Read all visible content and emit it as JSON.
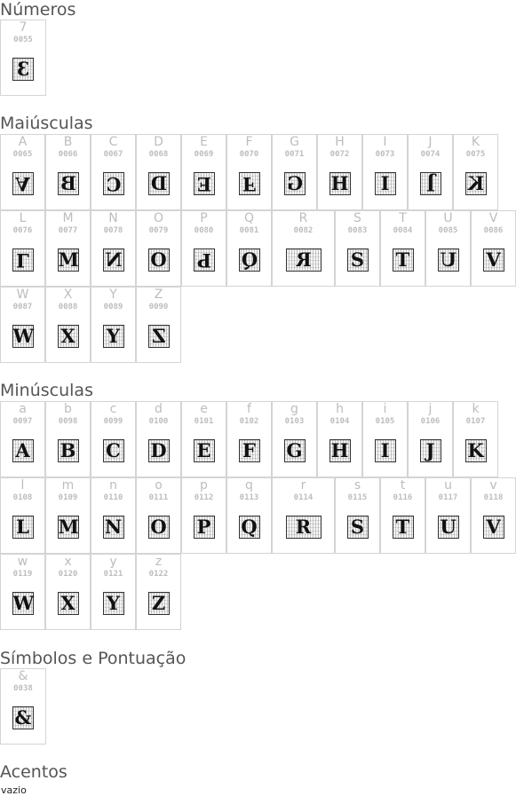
{
  "sections": {
    "numeros": {
      "title": "Números",
      "cells": [
        {
          "char": "7",
          "code": "0055",
          "glyph": "3",
          "transform": "mirror"
        }
      ]
    },
    "maiusculas": {
      "title": "Maiúsculas",
      "cells": [
        {
          "char": "A",
          "code": "0065",
          "glyph": "A",
          "transform": "flip"
        },
        {
          "char": "B",
          "code": "0066",
          "glyph": "B",
          "transform": "mirror"
        },
        {
          "char": "C",
          "code": "0067",
          "glyph": "C",
          "transform": "rot"
        },
        {
          "char": "D",
          "code": "0068",
          "glyph": "D",
          "transform": "mirror"
        },
        {
          "char": "E",
          "code": "0069",
          "glyph": "E",
          "transform": "rot"
        },
        {
          "char": "F",
          "code": "0070",
          "glyph": "F",
          "transform": "flip"
        },
        {
          "char": "G",
          "code": "0071",
          "glyph": "G",
          "transform": "mirror"
        },
        {
          "char": "H",
          "code": "0072",
          "glyph": "H",
          "transform": "none"
        },
        {
          "char": "I",
          "code": "0073",
          "glyph": "I",
          "transform": "none"
        },
        {
          "char": "J",
          "code": "0074",
          "glyph": "J",
          "transform": "rot"
        },
        {
          "char": "K",
          "code": "0075",
          "glyph": "K",
          "transform": "mirror"
        },
        {
          "char": "L",
          "code": "0076",
          "glyph": "L",
          "transform": "flip"
        },
        {
          "char": "M",
          "code": "0077",
          "glyph": "M",
          "transform": "none"
        },
        {
          "char": "N",
          "code": "0078",
          "glyph": "N",
          "transform": "mirror"
        },
        {
          "char": "O",
          "code": "0079",
          "glyph": "O",
          "transform": "none"
        },
        {
          "char": "P",
          "code": "0080",
          "glyph": "P",
          "transform": "rot"
        },
        {
          "char": "Q",
          "code": "0081",
          "glyph": "Q",
          "transform": "mirror"
        },
        {
          "char": "R",
          "code": "0082",
          "glyph": "R",
          "transform": "mirror"
        },
        {
          "char": "S",
          "code": "0083",
          "glyph": "S",
          "transform": "none"
        },
        {
          "char": "T",
          "code": "0084",
          "glyph": "T",
          "transform": "none"
        },
        {
          "char": "U",
          "code": "0085",
          "glyph": "U",
          "transform": "mirror"
        },
        {
          "char": "V",
          "code": "0086",
          "glyph": "V",
          "transform": "none"
        },
        {
          "char": "W",
          "code": "0087",
          "glyph": "W",
          "transform": "none"
        },
        {
          "char": "X",
          "code": "0088",
          "glyph": "X",
          "transform": "none"
        },
        {
          "char": "Y",
          "code": "0089",
          "glyph": "Y",
          "transform": "none"
        },
        {
          "char": "Z",
          "code": "0090",
          "glyph": "Z",
          "transform": "mirror"
        }
      ]
    },
    "minusculas": {
      "title": "Minúsculas",
      "cells": [
        {
          "char": "a",
          "code": "0097",
          "glyph": "A",
          "transform": "none"
        },
        {
          "char": "b",
          "code": "0098",
          "glyph": "B",
          "transform": "none"
        },
        {
          "char": "c",
          "code": "0099",
          "glyph": "C",
          "transform": "none"
        },
        {
          "char": "d",
          "code": "0100",
          "glyph": "D",
          "transform": "none"
        },
        {
          "char": "e",
          "code": "0101",
          "glyph": "E",
          "transform": "none"
        },
        {
          "char": "f",
          "code": "0102",
          "glyph": "F",
          "transform": "none"
        },
        {
          "char": "g",
          "code": "0103",
          "glyph": "G",
          "transform": "none"
        },
        {
          "char": "h",
          "code": "0104",
          "glyph": "H",
          "transform": "none"
        },
        {
          "char": "i",
          "code": "0105",
          "glyph": "I",
          "transform": "none"
        },
        {
          "char": "j",
          "code": "0106",
          "glyph": "J",
          "transform": "none"
        },
        {
          "char": "k",
          "code": "0107",
          "glyph": "K",
          "transform": "none"
        },
        {
          "char": "l",
          "code": "0108",
          "glyph": "L",
          "transform": "none"
        },
        {
          "char": "m",
          "code": "0109",
          "glyph": "M",
          "transform": "none"
        },
        {
          "char": "n",
          "code": "0110",
          "glyph": "N",
          "transform": "none"
        },
        {
          "char": "o",
          "code": "0111",
          "glyph": "O",
          "transform": "none"
        },
        {
          "char": "p",
          "code": "0112",
          "glyph": "P",
          "transform": "none"
        },
        {
          "char": "q",
          "code": "0113",
          "glyph": "Q",
          "transform": "none"
        },
        {
          "char": "r",
          "code": "0114",
          "glyph": "R",
          "transform": "none"
        },
        {
          "char": "s",
          "code": "0115",
          "glyph": "S",
          "transform": "none"
        },
        {
          "char": "t",
          "code": "0116",
          "glyph": "T",
          "transform": "none"
        },
        {
          "char": "u",
          "code": "0117",
          "glyph": "U",
          "transform": "none"
        },
        {
          "char": "v",
          "code": "0118",
          "glyph": "V",
          "transform": "none"
        },
        {
          "char": "w",
          "code": "0119",
          "glyph": "W",
          "transform": "none"
        },
        {
          "char": "x",
          "code": "0120",
          "glyph": "X",
          "transform": "none"
        },
        {
          "char": "y",
          "code": "0121",
          "glyph": "Y",
          "transform": "none"
        },
        {
          "char": "z",
          "code": "0122",
          "glyph": "Z",
          "transform": "none"
        }
      ]
    },
    "simbolos": {
      "title": "Símbolos e Pontuação",
      "cells": [
        {
          "char": "&",
          "code": "0038",
          "glyph": "&",
          "transform": "none"
        }
      ]
    },
    "acentos": {
      "title": "Acentos",
      "empty_text": "vazio"
    }
  }
}
